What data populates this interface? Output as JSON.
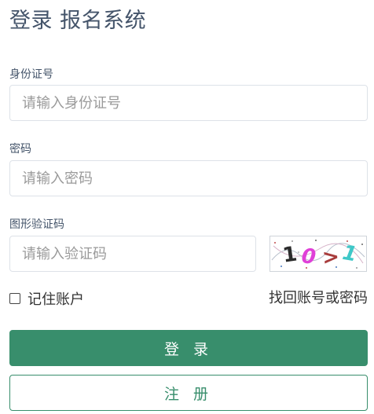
{
  "page": {
    "title": "登录 报名系统"
  },
  "form": {
    "id_card": {
      "label": "身份证号",
      "placeholder": "请输入身份证号",
      "value": ""
    },
    "password": {
      "label": "密码",
      "placeholder": "请输入密码",
      "value": ""
    },
    "captcha": {
      "label": "图形验证码",
      "placeholder": "请输入验证码",
      "value": "",
      "image_text": [
        "1",
        "0",
        ">",
        "1"
      ],
      "image_colors": [
        "#2b2b2b",
        "#e040d8",
        "#a83c3c",
        "#3fc8c8"
      ]
    },
    "remember": {
      "label": "记住账户",
      "checked": false
    },
    "forgot_link": "找回账号或密码"
  },
  "actions": {
    "login_label": "登 录",
    "register_label": "注 册"
  },
  "colors": {
    "primary": "#388e6c",
    "title": "#44546a",
    "input_border": "#dde2e8",
    "placeholder": "#9a9a9a"
  }
}
